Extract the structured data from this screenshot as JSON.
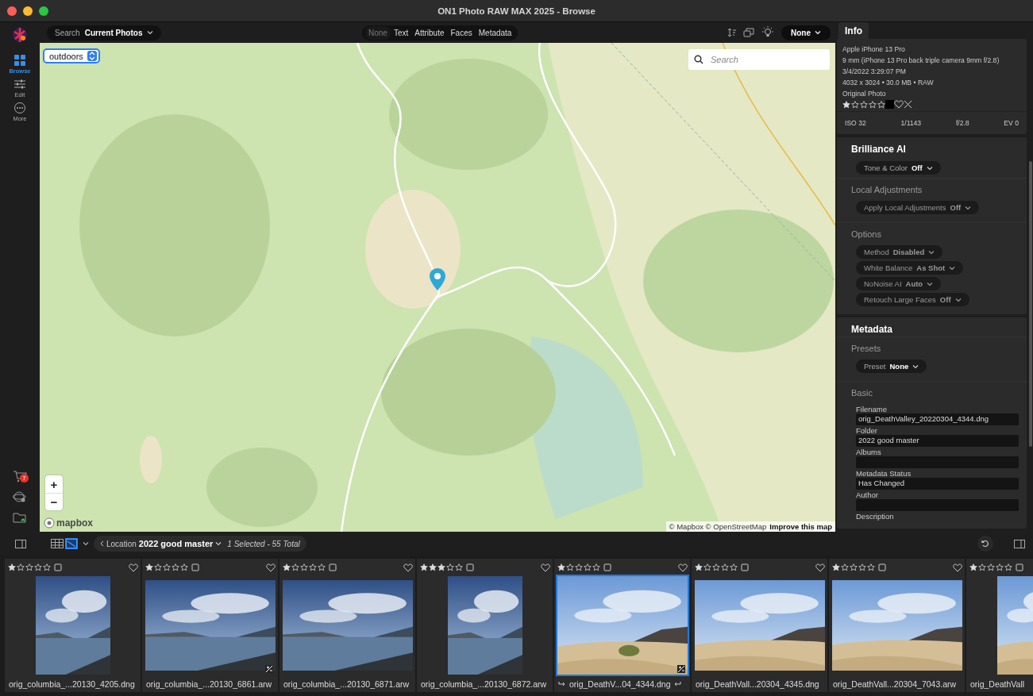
{
  "window": {
    "title": "ON1 Photo RAW MAX 2025 - Browse"
  },
  "sidebar": {
    "items": [
      {
        "kind": "browse",
        "label": "Browse",
        "selected": true
      },
      {
        "kind": "edit",
        "label": "Edit",
        "selected": false
      },
      {
        "kind": "more",
        "label": "More",
        "selected": false
      }
    ],
    "cart_badge": "7"
  },
  "toolbar": {
    "search_label": "Search",
    "search_scope": "Current Photos",
    "filter_tabs": [
      {
        "label": "None",
        "selected": true
      },
      {
        "label": "Text",
        "selected": false
      },
      {
        "label": "Attribute",
        "selected": false
      },
      {
        "label": "Faces",
        "selected": false
      },
      {
        "label": "Metadata",
        "selected": false
      }
    ],
    "sort_value": "None"
  },
  "map": {
    "style": "outdoors",
    "search_placeholder": "Search",
    "zoom_in": "+",
    "zoom_out": "−",
    "logo": "mapbox",
    "attribution": "© Mapbox © OpenStreetMap",
    "improve_link": "Improve this map"
  },
  "info_panel": {
    "tab": "Info",
    "camera": "Apple iPhone 13 Pro",
    "lens": "9 mm (iPhone 13 Pro back triple camera 9mm f/2.8)",
    "date": "3/4/2022 3:29:07 PM",
    "details": "4032 x 3024 • 30.0 MB • RAW",
    "version": "Original Photo",
    "stars": 1,
    "exif": [
      "ISO 32",
      "1/1143",
      "f/2.8",
      "EV 0"
    ]
  },
  "brilliance_ai": {
    "title": "Brilliance AI",
    "dropdowns": [
      {
        "label": "Tone & Color",
        "value": "Off"
      }
    ],
    "subsections": [
      {
        "heading": "Local Adjustments",
        "dropdowns": [
          {
            "label": "Apply Local Adjustments",
            "value": "Off"
          }
        ]
      },
      {
        "heading": "Options",
        "dropdowns": [
          {
            "label": "Method",
            "value": "Disabled"
          },
          {
            "label": "White Balance",
            "value": "As Shot"
          },
          {
            "label": "NoNoise AI",
            "value": "Auto"
          },
          {
            "label": "Retouch Large Faces",
            "value": "Off"
          }
        ]
      }
    ]
  },
  "metadata": {
    "title": "Metadata",
    "subsections": [
      {
        "heading": "Presets",
        "dropdowns": [
          {
            "label": "Preset",
            "value": "None"
          }
        ]
      },
      {
        "heading": "Basic",
        "fields": [
          {
            "label": "Filename",
            "value": "orig_DeathValley_20220304_4344.dng"
          },
          {
            "label": "Folder",
            "value": "2022 good master"
          },
          {
            "label": "Albums"
          },
          {
            "label": "Metadata Status",
            "value": "Has Changed"
          },
          {
            "label": "Author"
          },
          {
            "label": "Description"
          }
        ]
      }
    ]
  },
  "bottom_bar": {
    "view_modes": [
      {
        "kind": "grid",
        "selected": false
      },
      {
        "kind": "map",
        "selected": true
      }
    ],
    "location_label": "Location",
    "location_value": "2022 good master",
    "selection_count": "1 Selected - 55 Total"
  },
  "filmstrip": [
    {
      "stars": 1,
      "filename": "orig_columbia_...20130_4205.dng",
      "selected": false,
      "adjusted": false
    },
    {
      "stars": 1,
      "filename": "orig_columbia_...20130_6861.arw",
      "selected": false,
      "adjusted": true
    },
    {
      "stars": 1,
      "filename": "orig_columbia_...20130_6871.arw",
      "selected": false,
      "adjusted": false
    },
    {
      "stars": 3,
      "filename": "orig_columbia_...20130_6872.arw",
      "selected": false,
      "adjusted": false
    },
    {
      "stars": 1,
      "filename": "orig_DeathV...04_4344.dng",
      "selected": true,
      "adjusted": true
    },
    {
      "stars": 1,
      "filename": "orig_DeathVall...20304_4345.dng",
      "selected": false,
      "adjusted": false
    },
    {
      "stars": 1,
      "filename": "orig_DeathVall...20304_7043.arw",
      "selected": false,
      "adjusted": false
    },
    {
      "stars": 1,
      "filename": "orig_DeathVall",
      "selected": false,
      "adjusted": false
    }
  ]
}
